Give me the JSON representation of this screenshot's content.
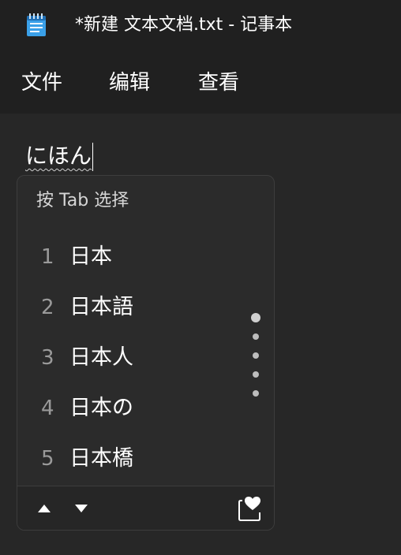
{
  "window": {
    "title": "*新建 文本文档.txt - 记事本",
    "icon": "notepad-icon"
  },
  "menu": {
    "file": "文件",
    "edit": "编辑",
    "view": "查看"
  },
  "editor": {
    "text": "にほん"
  },
  "ime": {
    "hint": "按 Tab 选择",
    "candidates": [
      {
        "num": "1",
        "text": "日本"
      },
      {
        "num": "2",
        "text": "日本語"
      },
      {
        "num": "3",
        "text": "日本人"
      },
      {
        "num": "4",
        "text": "日本の"
      },
      {
        "num": "5",
        "text": "日本橋"
      }
    ],
    "page_dots": 5,
    "active_page": 1,
    "icons": {
      "prev": "triangle-up-icon",
      "next": "triangle-down-icon",
      "favorite": "heart-clipboard-icon"
    }
  },
  "colors": {
    "titlebar_bg": "#202020",
    "editor_bg": "#272727",
    "panel_bg": "#2b2b2b",
    "text": "#ffffff"
  }
}
